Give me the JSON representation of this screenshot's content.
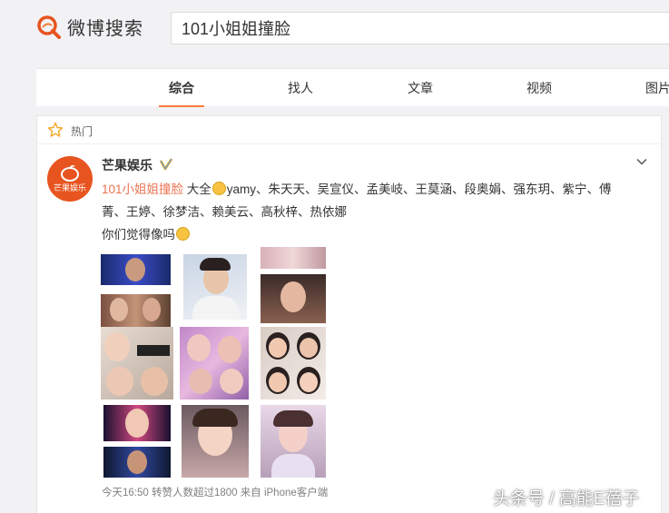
{
  "header": {
    "logo_text": "微博搜索",
    "search_value": "101小姐姐撞脸"
  },
  "tabs": [
    {
      "label": "综合",
      "active": true
    },
    {
      "label": "找人",
      "active": false
    },
    {
      "label": "文章",
      "active": false
    },
    {
      "label": "视频",
      "active": false
    },
    {
      "label": "图片",
      "active": false
    }
  ],
  "card": {
    "section_label": "热门",
    "author": "芒果娱乐",
    "avatar_text": "芒果娱乐",
    "topic": "101小姐姐撞脸",
    "text_after_topic": " 大全",
    "names_line1": "yamy、朱天天、吴宣仪、孟美岐、王莫涵、段奥娟、强东玥、紫宁、傅",
    "names_line2": "菁、王婷、徐梦洁、赖美云、高秋梓、热依娜",
    "question": "你们觉得像吗",
    "meta": "今天16:50 转赞人数超过1800 来自 iPhone客户端"
  },
  "watermark": "头条号 / 高能E蓓子",
  "colors": {
    "accent": "#fa7d3c",
    "topic": "#eb7350",
    "verified": "#ffa500",
    "avatar_bg": "#e8541f"
  }
}
